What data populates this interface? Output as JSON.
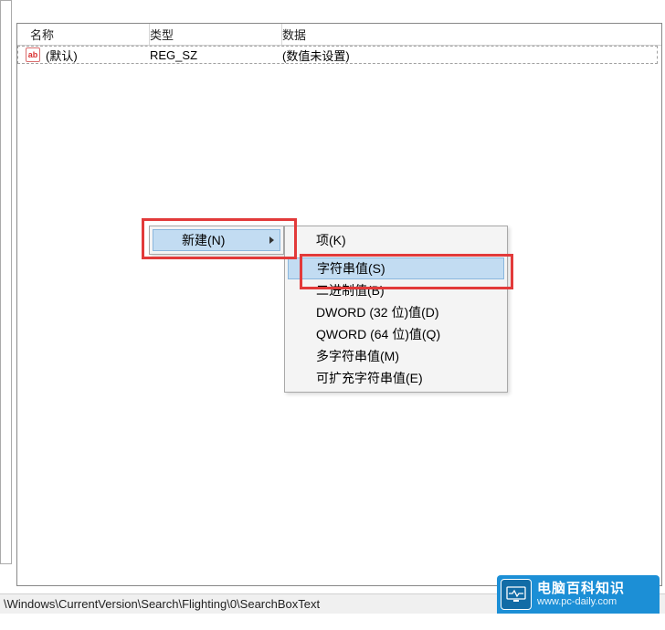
{
  "columns": {
    "name": "名称",
    "type": "类型",
    "data": "数据"
  },
  "row": {
    "icon_text": "ab",
    "name": "(默认)",
    "type": "REG_SZ",
    "data": "(数值未设置)"
  },
  "context_menu": {
    "primary": {
      "new_label": "新建(N)"
    },
    "secondary": {
      "key": "项(K)",
      "string": "字符串值(S)",
      "binary": "二进制值(B)",
      "dword": "DWORD (32 位)值(D)",
      "qword": "QWORD (64 位)值(Q)",
      "multistring": "多字符串值(M)",
      "expandstring": "可扩充字符串值(E)"
    }
  },
  "statusbar": {
    "path": "\\Windows\\CurrentVersion\\Search\\Flighting\\0\\SearchBoxText"
  },
  "watermark": {
    "title": "电脑百科知识",
    "url": "www.pc-daily.com"
  }
}
